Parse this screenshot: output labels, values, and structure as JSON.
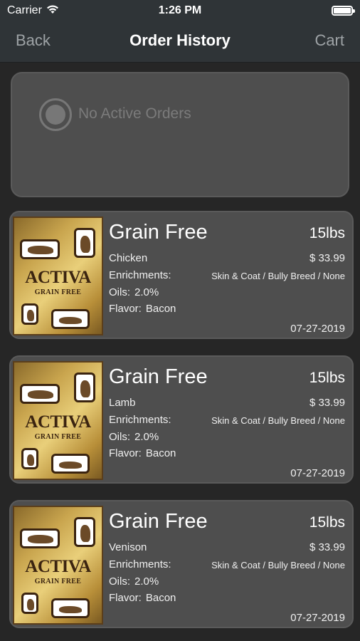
{
  "status_bar": {
    "carrier": "Carrier",
    "time": "1:26 PM"
  },
  "nav": {
    "back_label": "Back",
    "title": "Order History",
    "cart_label": "Cart"
  },
  "active_orders": {
    "text": "No Active Orders"
  },
  "orders": [
    {
      "name": "Grain Free",
      "weight": "15lbs",
      "protein": "Chicken",
      "price": "$ 33.99",
      "enrichments_label": "Enrichments:",
      "enrichments_value": "Skin & Coat / Bully Breed / None",
      "oils_label": "Oils:",
      "oils_value": "2.0%",
      "flavor_label": "Flavor:",
      "flavor_value": "Bacon",
      "date": "07-27-2019",
      "brand": "ACTIVA",
      "brand_sub": "GRAIN FREE"
    },
    {
      "name": "Grain Free",
      "weight": "15lbs",
      "protein": "Lamb",
      "price": "$ 33.99",
      "enrichments_label": "Enrichments:",
      "enrichments_value": "Skin & Coat / Bully Breed / None",
      "oils_label": "Oils:",
      "oils_value": "2.0%",
      "flavor_label": "Flavor:",
      "flavor_value": "Bacon",
      "date": "07-27-2019",
      "brand": "ACTIVA",
      "brand_sub": "GRAIN FREE"
    },
    {
      "name": "Grain Free",
      "weight": "15lbs",
      "protein": "Venison",
      "price": "$ 33.99",
      "enrichments_label": "Enrichments:",
      "enrichments_value": "Skin & Coat / Bully Breed / None",
      "oils_label": "Oils:",
      "oils_value": "2.0%",
      "flavor_label": "Flavor:",
      "flavor_value": "Bacon",
      "date": "07-27-2019",
      "brand": "ACTIVA",
      "brand_sub": "GRAIN FREE"
    }
  ]
}
